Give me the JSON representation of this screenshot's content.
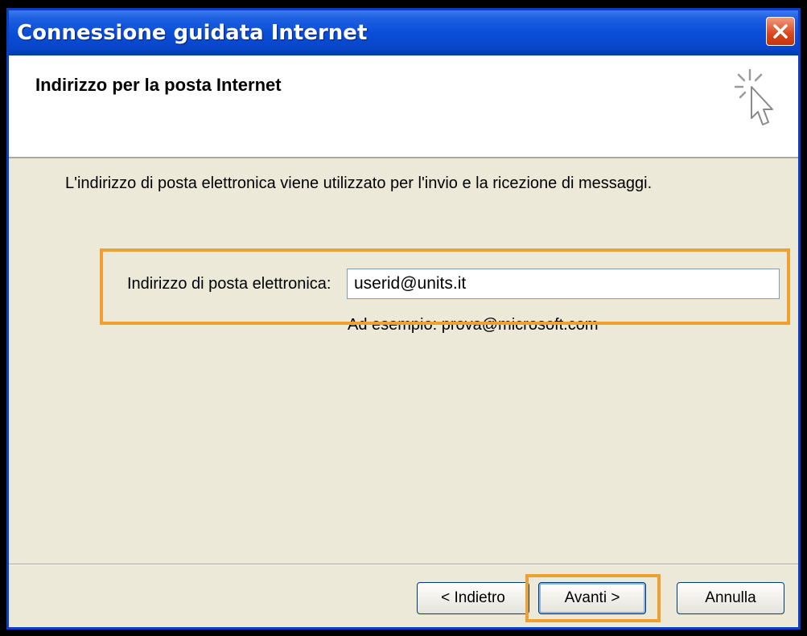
{
  "window": {
    "title": "Connessione guidata Internet",
    "close_icon": "close-icon"
  },
  "header": {
    "title": "Indirizzo per la posta Internet",
    "icon": "wizard-cursor-icon"
  },
  "content": {
    "description": "L'indirizzo di posta elettronica viene utilizzato per l'invio e la ricezione di messaggi.",
    "email_label": "Indirizzo di posta elettronica:",
    "email_value": "userid@units.it",
    "example": "Ad esempio: prova@microsoft.com"
  },
  "buttons": {
    "back": "< Indietro",
    "next": "Avanti >",
    "cancel": "Annulla"
  },
  "colors": {
    "highlight": "#f0a030",
    "titlebar": "#0a4fd8",
    "dialog_bg": "#ece9d8"
  }
}
